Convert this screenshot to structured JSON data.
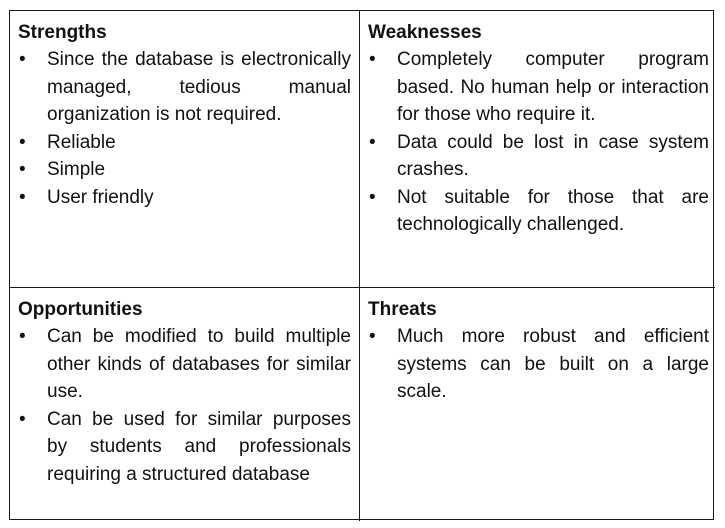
{
  "strengths": {
    "title": "Strengths",
    "items": [
      "Since the database is electronically managed, tedious manual organization is not required.",
      "Reliable",
      "Simple",
      "User friendly"
    ]
  },
  "weaknesses": {
    "title": "Weaknesses",
    "items": [
      "Completely computer program based. No human help or interaction for those who require it.",
      "Data could be lost in case system crashes.",
      "Not suitable for those that are technologically challenged."
    ]
  },
  "opportunities": {
    "title": "Opportunities",
    "items": [
      "Can be modified to build multiple other kinds of databases for similar use.",
      "Can be used for similar purposes by students and professionals requiring a structured database"
    ]
  },
  "threats": {
    "title": "Threats",
    "items": [
      "Much more robust and efficient systems can be built on a large scale."
    ]
  },
  "bullet_glyph": "•"
}
